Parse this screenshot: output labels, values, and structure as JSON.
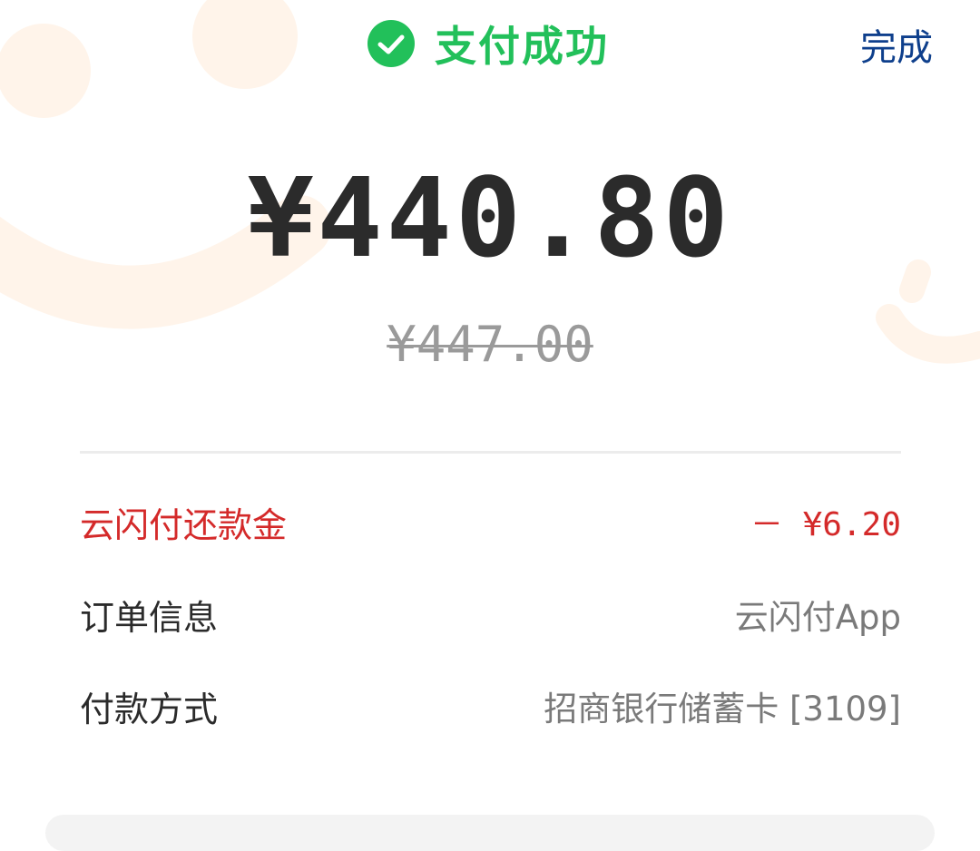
{
  "header": {
    "status_text": "支付成功",
    "done_label": "完成",
    "check_icon": "check-circle-icon",
    "status_color": "#22c05a",
    "done_color": "#0e3f8c"
  },
  "payment": {
    "paid_amount": "¥440.80",
    "original_amount": "¥447.00"
  },
  "details": [
    {
      "label": "云闪付还款金",
      "value": "－ ¥6.20",
      "color": "#d42a2a"
    },
    {
      "label": "订单信息",
      "value": "云闪付App"
    },
    {
      "label": "付款方式",
      "value": "招商银行储蓄卡 [3109]"
    }
  ]
}
